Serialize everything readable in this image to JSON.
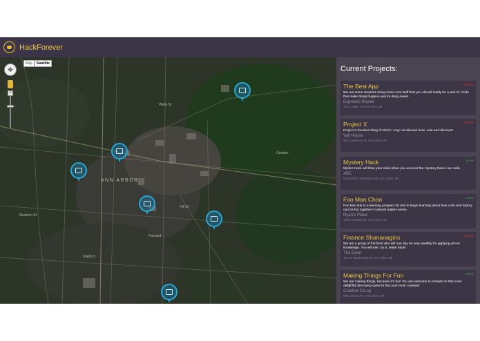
{
  "app": {
    "title": "HackForever"
  },
  "map": {
    "type_buttons": [
      "Map",
      "Satellite"
    ],
    "selected_type": "Satellite",
    "marker_count": 6,
    "colors": {
      "pin": "#29a8d6"
    },
    "labels": [
      "ANN ARBOR",
      "Madison St",
      "Wells St",
      "Hill St",
      "Packard",
      "Stadium",
      "Geddes"
    ]
  },
  "panel": {
    "title": "Current Projects:",
    "projects": [
      {
        "name": "The Best App",
        "status": "inactive",
        "status_color": "#d8342c",
        "description": "We are some students doing some cool stuff that you should totally be a part of. Code that make things happen and its dang sweet.",
        "venue": "Espresso Royale",
        "address": "214 S Main St Ann Arbor, MI"
      },
      {
        "name": "Project X",
        "status": "inactive",
        "status_color": "#d8342c",
        "description": "Project X involves thing of which I may not discuss here. Join and discover!",
        "venue": "Vail House",
        "address": "602 Lawrence St. Ann Arbor, MI"
      },
      {
        "name": "Mystery Hack",
        "status": "active",
        "status_color": "#3fa542",
        "description": "Myster Hack will blow your mind when you uncover the mystery that is our code.",
        "venue": "ABC",
        "address": "618 South University Ave. Ann Arbor, MI"
      },
      {
        "name": "Foo Man Choo",
        "status": "active",
        "status_color": "#3fa542",
        "description": "Foo Man Bar is a learning program for tots to begin learning about how code and history can be fun together! It almost makes sense.",
        "venue": "Ryan's Place",
        "address": "1435 Packard St. Ann Arbor, MI"
      },
      {
        "name": "Finance Shananagins",
        "status": "inactive",
        "status_color": "#d8342c",
        "description": "We are a group of frat bros who will one day be very wealthy for applying all our knowledge. You will see. Do it. Make bank!",
        "venue": "The Earle",
        "address": "121 W Washenaw St. Ann Arbor, MI"
      },
      {
        "name": "Making Things For Fun",
        "status": "active",
        "status_color": "#3fa542",
        "description": "We are making things, because it's fun! You are welcome to embark on this most delightful discovery quest to find your inner codester.",
        "venue": "Creative Co-op",
        "address": "635 Oxford Rd. Ann Arbor, MI"
      }
    ]
  }
}
